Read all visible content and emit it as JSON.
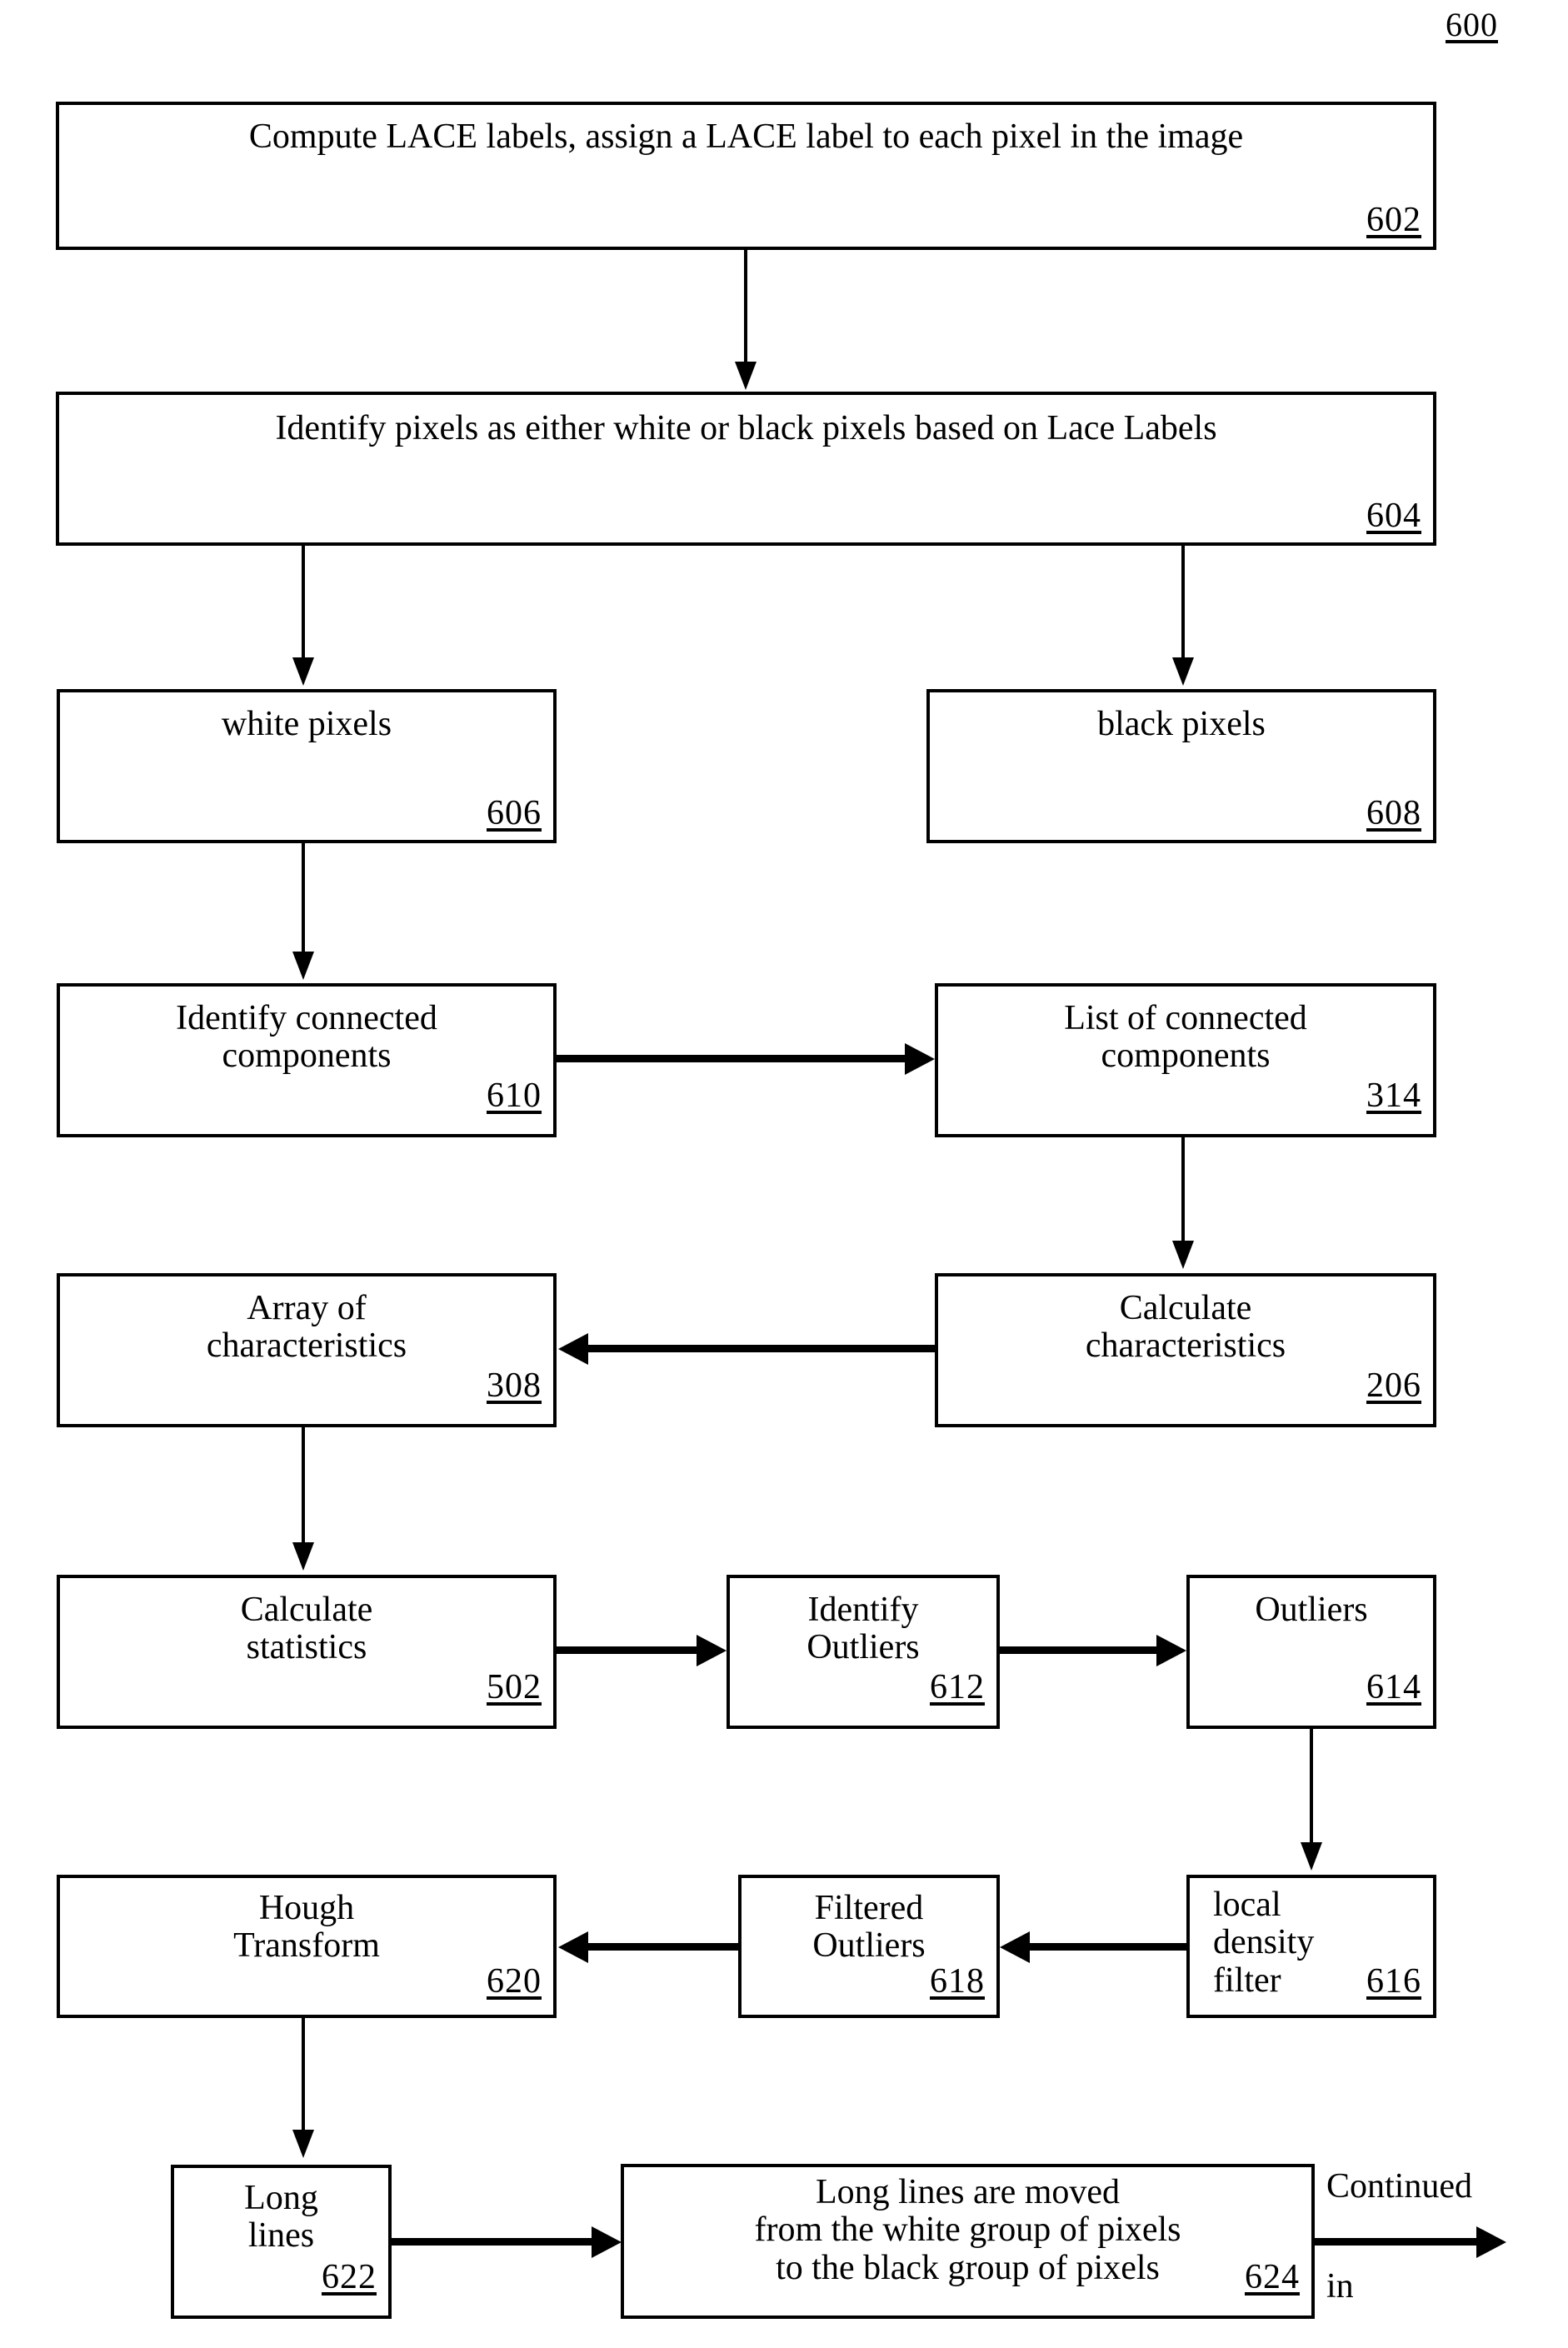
{
  "figure": {
    "number": "600"
  },
  "nodes": {
    "n602": {
      "text": "Compute LACE labels, assign a LACE label to each pixel in the image",
      "ref": "602"
    },
    "n604": {
      "text": "Identify pixels as either white or black pixels based on Lace Labels",
      "ref": "604"
    },
    "n606": {
      "text": "white pixels",
      "ref": "606"
    },
    "n608": {
      "text": "black pixels",
      "ref": "608"
    },
    "n610": {
      "text": "Identify connected\ncomponents",
      "ref": "610"
    },
    "n314": {
      "text": "List of connected\ncomponents",
      "ref": "314"
    },
    "n308": {
      "text": "Array of\ncharacteristics",
      "ref": "308"
    },
    "n206": {
      "text": "Calculate\ncharacteristics",
      "ref": "206"
    },
    "n502": {
      "text": "Calculate\nstatistics",
      "ref": "502"
    },
    "n612": {
      "text": "Identify\nOutliers",
      "ref": "612"
    },
    "n614": {
      "text": "Outliers",
      "ref": "614"
    },
    "n616": {
      "text": "local\ndensity\nfilter",
      "ref": "616"
    },
    "n618": {
      "text": "Filtered\nOutliers",
      "ref": "618"
    },
    "n620": {
      "text": "Hough\nTransform",
      "ref": "620"
    },
    "n622": {
      "text": "Long\nlines",
      "ref": "622"
    },
    "n624": {
      "text": "Long lines are moved\nfrom the white group of pixels\nto the black group of pixels",
      "ref": "624"
    }
  },
  "annotations": {
    "continued": "Continued",
    "in": "in"
  },
  "colors": {
    "ink": "#000000",
    "paper": "#ffffff"
  }
}
